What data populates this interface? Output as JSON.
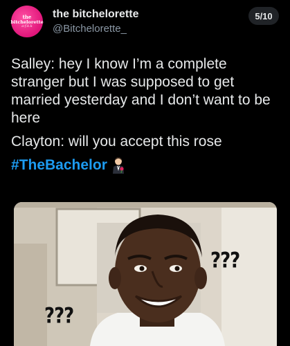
{
  "header": {
    "avatar_text": [
      "the",
      "bitchelorette",
      "a-f.k.k"
    ],
    "display_name": "the bitchelorette",
    "handle": "@Bitchelorette_",
    "page_counter": "5/10"
  },
  "tweet": {
    "line1": "Salley: hey I know I’m a complete stranger but I was supposed to get married yesterday and I don’t want to be here",
    "line2": "Clayton: will you accept this rose",
    "hashtag": "#TheBachelor",
    "emoji": "man-in-tuxedo-with-rose-icon"
  },
  "media": {
    "left_caption": "???",
    "right_caption": "???"
  },
  "colors": {
    "background": "#000000",
    "text": "#e7e9ea",
    "secondary": "#8b98a5",
    "hashtag": "#1d9bf0",
    "avatar": "#e0157a"
  }
}
